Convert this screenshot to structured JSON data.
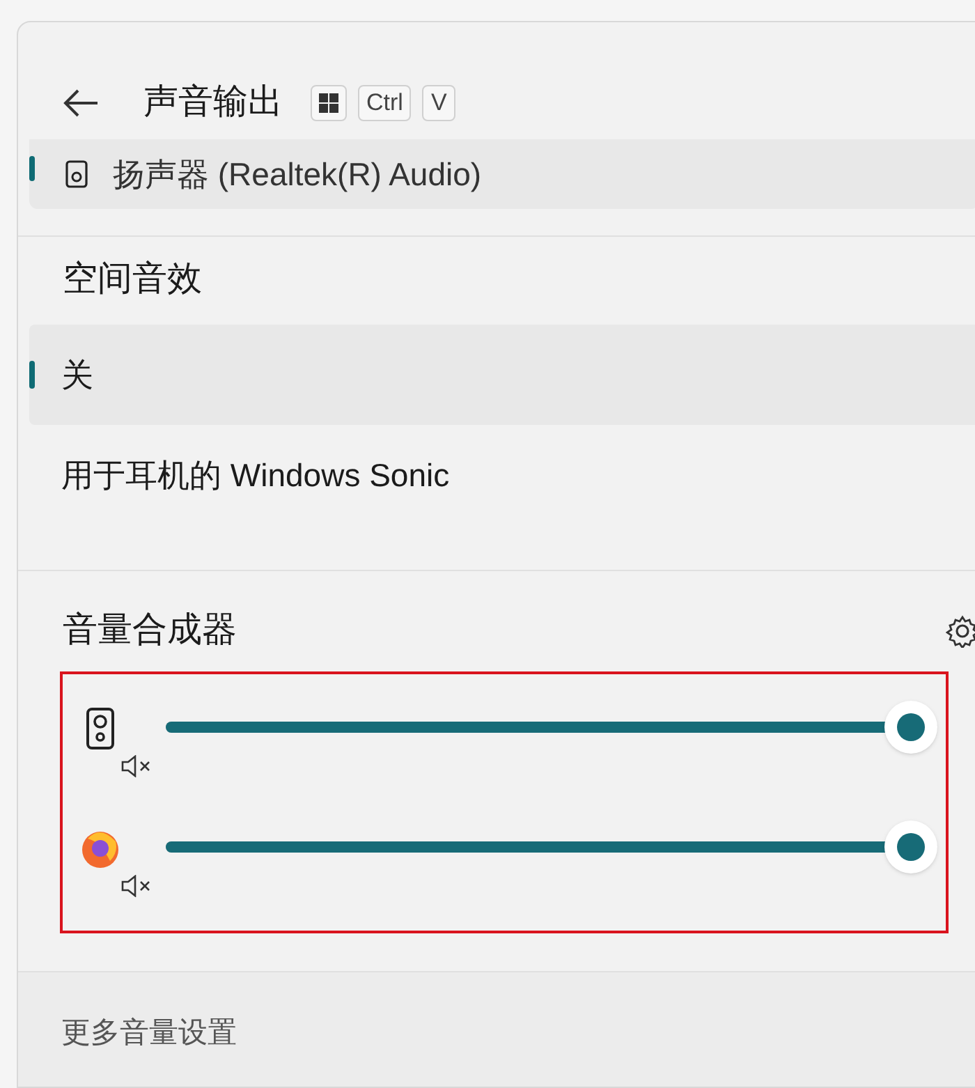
{
  "header": {
    "title": "声音输出",
    "keys": [
      {
        "kind": "windows"
      },
      {
        "kind": "text",
        "label": "Ctrl"
      },
      {
        "kind": "text",
        "label": "V"
      }
    ]
  },
  "device": {
    "name": "扬声器 (Realtek(R) Audio)",
    "selected": true
  },
  "spatial": {
    "title": "空间音效",
    "options": [
      {
        "label": "关",
        "selected": true
      },
      {
        "label": "用于耳机的 Windows Sonic",
        "selected": false
      }
    ]
  },
  "mixer": {
    "title": "音量合成器",
    "highlighted": true,
    "channels": [
      {
        "kind": "speaker",
        "level": 1
      },
      {
        "kind": "browser",
        "level": 1
      }
    ]
  },
  "footer": {
    "link": "更多音量设置"
  }
}
